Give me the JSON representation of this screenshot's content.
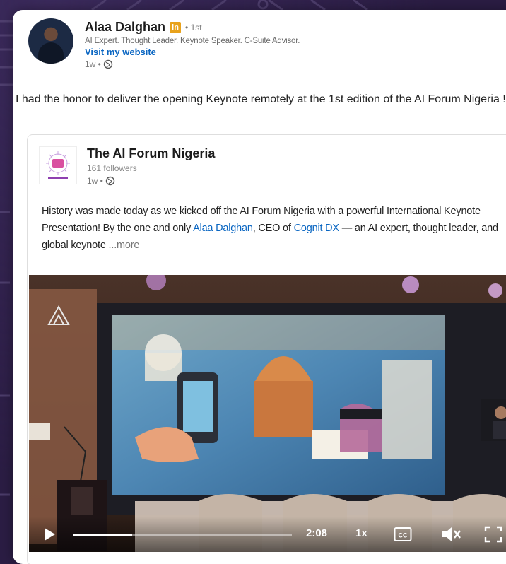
{
  "author": {
    "name": "Alaa Dalghan",
    "badge": "in",
    "degree": "• 1st",
    "headline": "AI Expert. Thought Leader. Keynote Speaker. C-Suite Advisor.",
    "website_label": "Visit my website",
    "time": "1w •"
  },
  "post": {
    "text": "I had the honor to deliver the opening Keynote remotely at the 1st edition of the AI Forum Nigeria !"
  },
  "repost": {
    "org_name": "The AI Forum Nigeria",
    "followers": "161 followers",
    "time": "1w •",
    "text_part1": "History was made today as we kicked off the AI Forum Nigeria with a powerful International Keynote Presentation! By the one and only ",
    "mention1": "Alaa Dalghan",
    "text_part2": ", CEO of ",
    "mention2": "Cognit DX",
    "text_part3": " — an AI expert, thought leader, and global keynote ",
    "more_label": "...more"
  },
  "video": {
    "time": "2:08",
    "speed": "1x",
    "cc_label": "CC",
    "progress": 0.27
  },
  "colors": {
    "link": "#0a66c2",
    "badge": "#e8a21c",
    "background": "#2b1d44"
  },
  "icons": [
    "globe-icon",
    "play-icon",
    "cc-icon",
    "mute-icon",
    "fullscreen-icon"
  ]
}
